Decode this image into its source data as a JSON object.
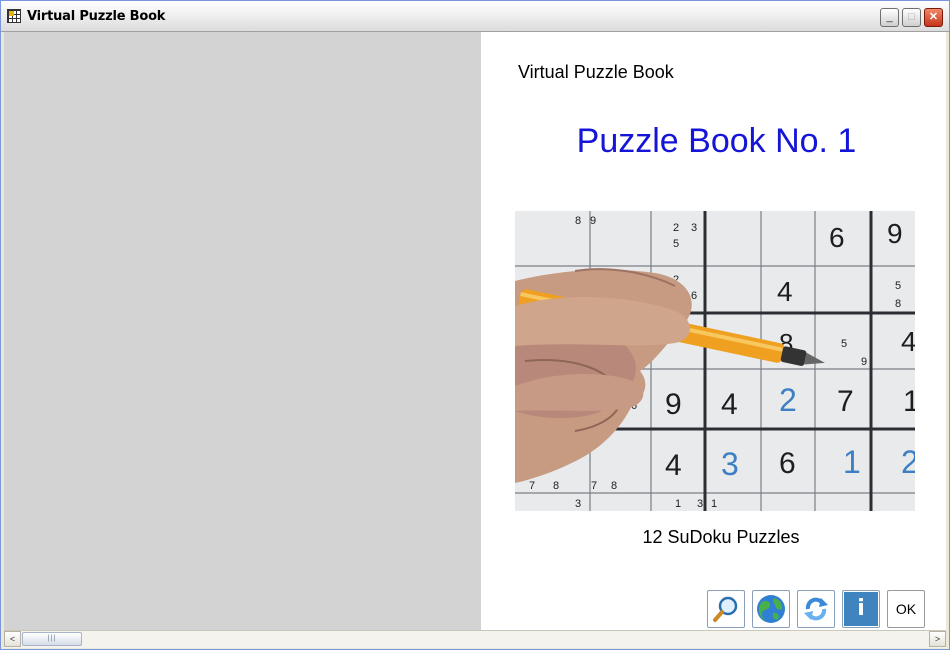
{
  "window": {
    "title": "Virtual Puzzle Book",
    "icon": "puzzle-grid-icon",
    "controls": {
      "minimize": "_",
      "maximize": "□",
      "close": "✕"
    }
  },
  "book": {
    "header": "Virtual Puzzle Book",
    "title": "Puzzle Book No. 1",
    "cover_image": "sudoku-with-pen-photo",
    "subtitle": "12 SuDoku Puzzles"
  },
  "toolbar": {
    "zoom_icon": "magnifier-icon",
    "web_icon": "globe-icon",
    "refresh_icon": "refresh-icon",
    "info_label": "i",
    "ok_label": "OK"
  },
  "scrollbar": {
    "left_arrow": "<",
    "right_arrow": ">",
    "thumb_grip": "|||"
  },
  "colors": {
    "title_blue": "#1515d8",
    "left_page": "#d3d3d3",
    "info_button": "#3f83bf"
  }
}
